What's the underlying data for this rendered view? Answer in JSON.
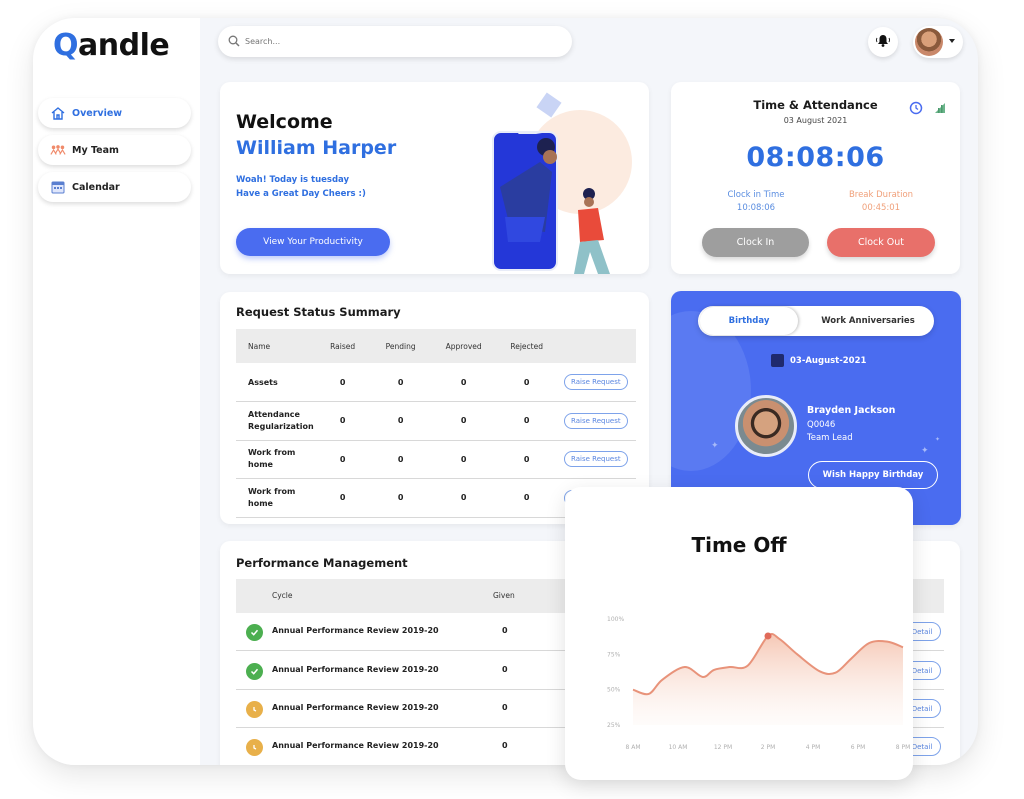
{
  "app": {
    "logo_q": "Q",
    "logo_rest": "andle"
  },
  "sidebar": {
    "items": [
      {
        "label": "Overview",
        "icon": "home-icon",
        "active": true
      },
      {
        "label": "My Team",
        "icon": "team-icon",
        "active": false
      },
      {
        "label": "Calendar",
        "icon": "calendar-icon",
        "active": false
      }
    ]
  },
  "header": {
    "search_placeholder": "Search...",
    "bell_icon": "bell-icon",
    "avatar_icon": "user-avatar"
  },
  "welcome": {
    "greeting": "Welcome",
    "name": "William Harper",
    "line1": "Woah! Today is tuesday",
    "line2": "Have a Great Day Cheers :)",
    "button": "View Your Productivity"
  },
  "attendance": {
    "title": "Time & Attendance",
    "date": "03 August 2021",
    "clock": "08:08:06",
    "clock_in_label": "Clock in Time",
    "clock_in_value": "10:08:06",
    "break_label": "Break Duration",
    "break_value": "00:45:01",
    "clock_in_button": "Clock In",
    "clock_out_button": "Clock Out"
  },
  "requests": {
    "title": "Request Status Summary",
    "columns": [
      "Name",
      "Raised",
      "Pending",
      "Approved",
      "Rejected"
    ],
    "rows": [
      {
        "name": "Assets",
        "raised": "0",
        "pending": "0",
        "approved": "0",
        "rejected": "0",
        "action": "Raise Request"
      },
      {
        "name": "Attendance Regularization",
        "raised": "0",
        "pending": "0",
        "approved": "0",
        "rejected": "0",
        "action": "Raise Request"
      },
      {
        "name": "Work from home",
        "raised": "0",
        "pending": "0",
        "approved": "0",
        "rejected": "0",
        "action": "Raise Request"
      },
      {
        "name": "Work from home",
        "raised": "0",
        "pending": "0",
        "approved": "0",
        "rejected": "0",
        "action": "Raise Request"
      }
    ]
  },
  "birthday": {
    "tabs": [
      "Birthday",
      "Work Anniversaries"
    ],
    "active_tab": "Birthday",
    "date": "03-August-2021",
    "person_name": "Brayden Jackson",
    "person_code": "Q0046",
    "person_role": "Team Lead",
    "button": "Wish Happy Birthday"
  },
  "performance": {
    "title": "Performance Management",
    "columns": [
      "Cycle",
      "Given"
    ],
    "rows": [
      {
        "status": "completed",
        "cycle": "Annual Performance Review 2019-20",
        "given": "0",
        "action": "Detail"
      },
      {
        "status": "completed",
        "cycle": "Annual Performance Review 2019-20",
        "given": "0",
        "action": "Detail"
      },
      {
        "status": "pending",
        "cycle": "Annual Performance Review 2019-20",
        "given": "0",
        "action": "Detail"
      },
      {
        "status": "pending",
        "cycle": "Annual Performance Review 2019-20",
        "given": "0",
        "action": "Detail"
      }
    ]
  },
  "colors": {
    "brand_blue": "#2f6fe0",
    "button_blue": "#4a6cf0",
    "clock_out": "#e8706a",
    "clock_in": "#9e9e9e",
    "chart_line": "#e8937a",
    "success": "#4caf50",
    "pending": "#e8b04a"
  },
  "chart_data": {
    "type": "area",
    "title": "Time Off",
    "xlabel": "",
    "ylabel": "",
    "x_ticks": [
      "8 AM",
      "10 AM",
      "12 PM",
      "2 PM",
      "4 PM",
      "6 PM",
      "8 PM"
    ],
    "y_ticks": [
      "25%",
      "50%",
      "75%",
      "100%"
    ],
    "ylim": [
      25,
      100
    ],
    "xlim": [
      8,
      20
    ],
    "grid": false,
    "highlight_point": {
      "x": 14,
      "y": 88
    },
    "series": [
      {
        "name": "Time Off",
        "x": [
          8,
          8.7,
          9.3,
          10.3,
          11.1,
          11.6,
          12.3,
          13.1,
          14,
          14.5,
          15.3,
          16.3,
          17,
          17.7,
          18.5,
          19.3,
          20
        ],
        "y": [
          50,
          47,
          57,
          66,
          59,
          64,
          66,
          67,
          88,
          86,
          75,
          63,
          62,
          72,
          83,
          84,
          80
        ]
      }
    ]
  }
}
